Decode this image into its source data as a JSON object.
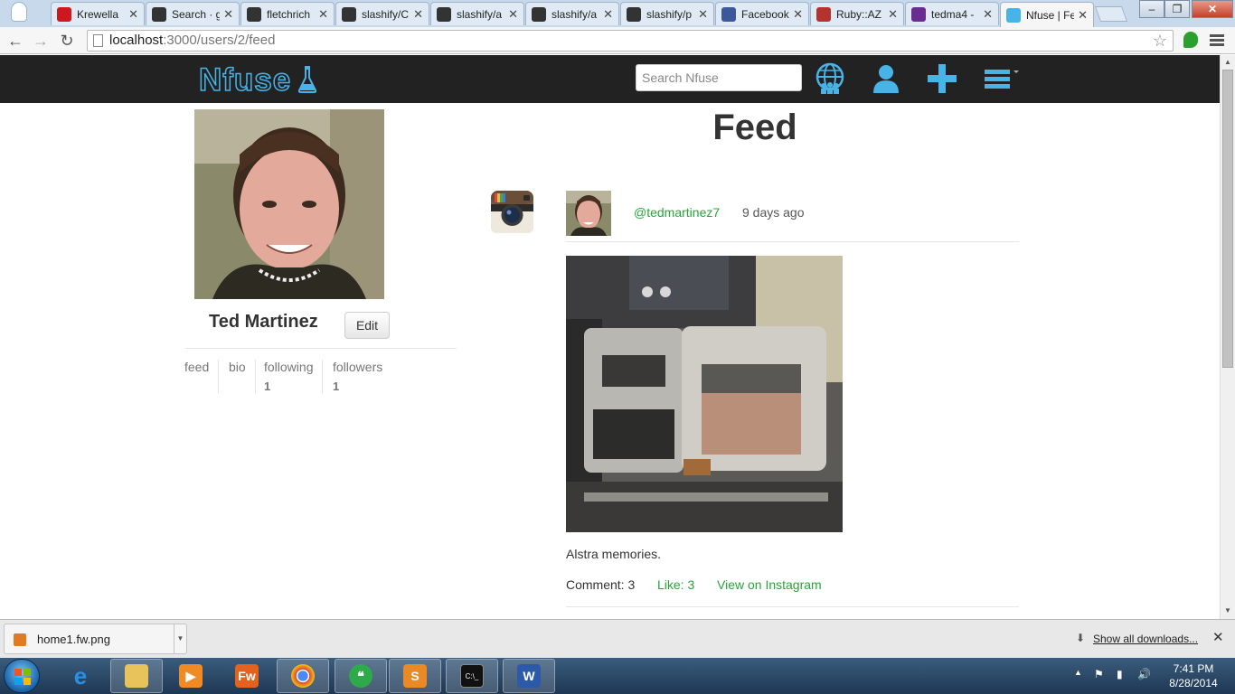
{
  "browser": {
    "tabs": [
      {
        "label": "Krewella",
        "favicon": "youtube-icon",
        "color": "#cc181e",
        "active": false
      },
      {
        "label": "Search · g",
        "favicon": "github-icon",
        "color": "#333333",
        "active": false
      },
      {
        "label": "fletchrich",
        "favicon": "github-icon",
        "color": "#333333",
        "active": false
      },
      {
        "label": "slashify/C",
        "favicon": "github-icon",
        "color": "#333333",
        "active": false
      },
      {
        "label": "slashify/a",
        "favicon": "github-icon",
        "color": "#333333",
        "active": false
      },
      {
        "label": "slashify/a",
        "favicon": "github-icon",
        "color": "#333333",
        "active": false
      },
      {
        "label": "slashify/p",
        "favicon": "github-icon",
        "color": "#333333",
        "active": false
      },
      {
        "label": "Facebook",
        "favicon": "facebook-icon",
        "color": "#3b5998",
        "active": false
      },
      {
        "label": "Ruby::AZ",
        "favicon": "ruby-icon",
        "color": "#b5332e",
        "active": false
      },
      {
        "label": "tedma4 -",
        "favicon": "mail-icon",
        "color": "#6a2c91",
        "active": false
      },
      {
        "label": "Nfuse | Fe",
        "favicon": "flask-icon",
        "color": "#48b3e6",
        "active": true
      }
    ],
    "url_host": "localhost",
    "url_path": ":3000/users/2/feed"
  },
  "navbar": {
    "brand": "Nfuse",
    "search_placeholder": "Search Nfuse",
    "icons": [
      "globe-people-icon",
      "user-icon",
      "plus-icon",
      "menu-icon"
    ],
    "accent": "#48b3e6"
  },
  "profile": {
    "name": "Ted Martinez",
    "edit_label": "Edit",
    "tabs": [
      {
        "label": "feed",
        "count": ""
      },
      {
        "label": "bio",
        "count": ""
      },
      {
        "label": "following",
        "count": "1"
      },
      {
        "label": "followers",
        "count": "1"
      }
    ]
  },
  "feed": {
    "title": "Feed",
    "post": {
      "source_icon": "instagram-icon",
      "username": "@tedmartinez7",
      "time": "9 days ago",
      "caption": "Alstra memories.",
      "comment": "Comment: 3",
      "like": "Like: 3",
      "view_link": "View on Instagram"
    }
  },
  "downloads": {
    "file": "home1.fw.png",
    "show_all": "Show all downloads..."
  },
  "taskbar": {
    "time": "7:41 PM",
    "date": "8/28/2014"
  }
}
